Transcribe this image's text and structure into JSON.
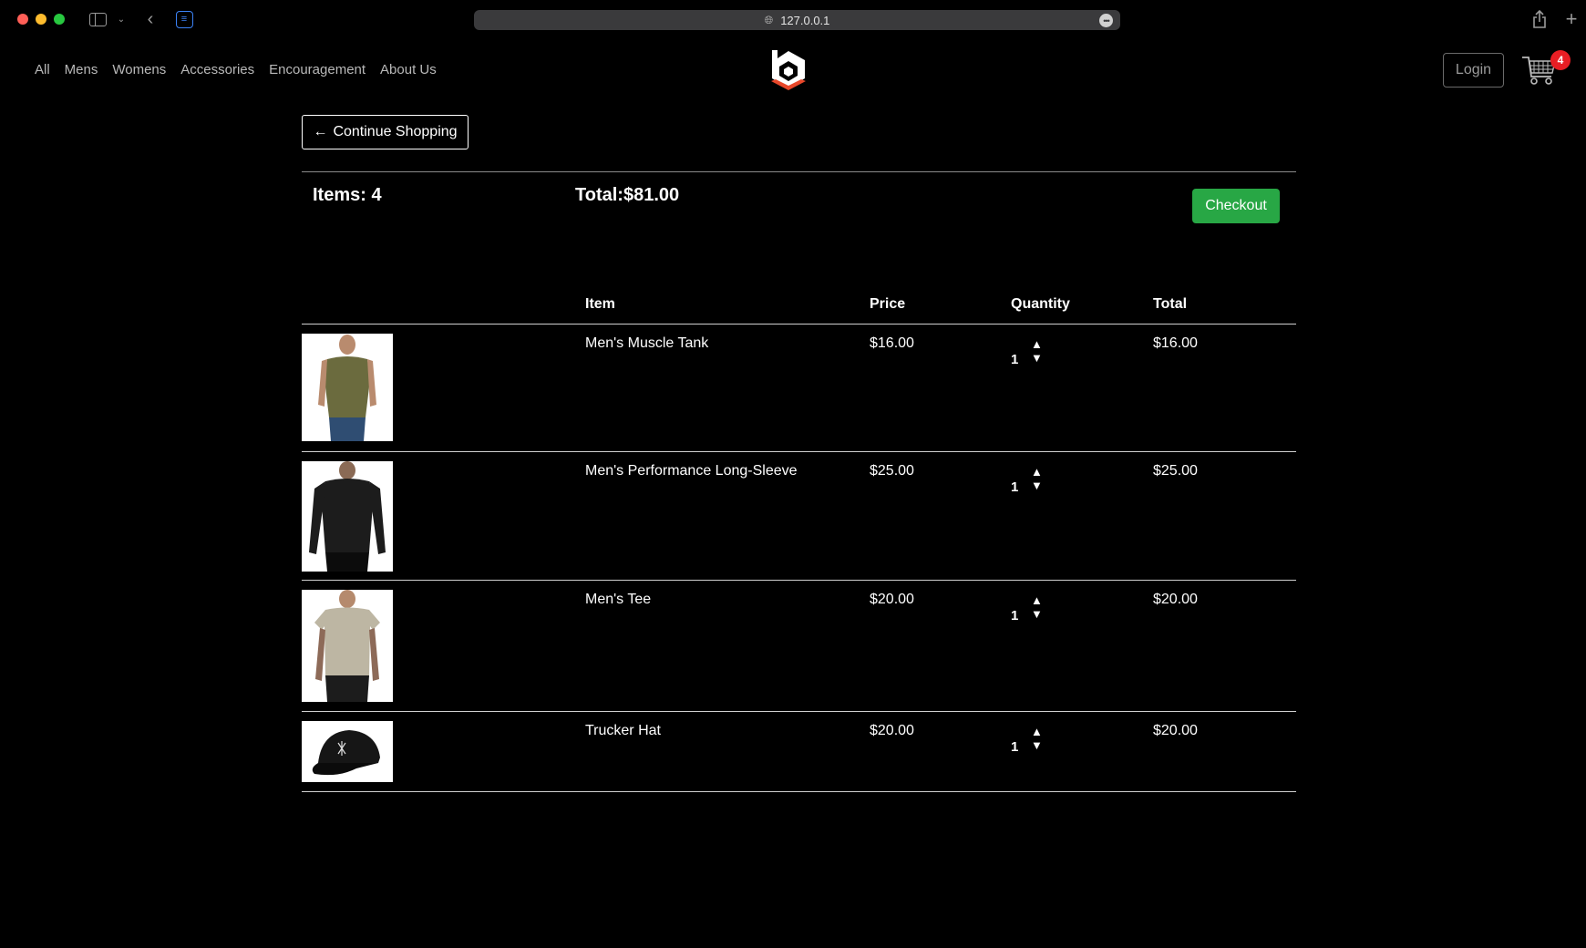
{
  "browser": {
    "url": "127.0.0.1",
    "icons": [
      "sidebar-icon",
      "chevron-down-icon",
      "back-arrow-icon",
      "extension-icon",
      "globe-icon",
      "more-icon",
      "share-icon",
      "new-tab-icon"
    ]
  },
  "nav": {
    "links": [
      "All",
      "Mens",
      "Womens",
      "Accessories",
      "Encouragement",
      "About Us"
    ],
    "login_label": "Login",
    "cart_count": "4"
  },
  "continue_label": "Continue Shopping",
  "summary": {
    "items_text": "Items: 4",
    "total_text": "Total:$81.00",
    "checkout_label": "Checkout"
  },
  "table": {
    "headers": {
      "item": "Item",
      "price": "Price",
      "quantity": "Quantity",
      "total": "Total"
    },
    "rows": [
      {
        "name": "Men's Muscle Tank",
        "price": "$16.00",
        "quantity": "1",
        "total": "$16.00"
      },
      {
        "name": "Men's Performance Long-Sleeve",
        "price": "$25.00",
        "quantity": "1",
        "total": "$25.00"
      },
      {
        "name": "Men's Tee",
        "price": "$20.00",
        "quantity": "1",
        "total": "$20.00"
      },
      {
        "name": "Trucker Hat",
        "price": "$20.00",
        "quantity": "1",
        "total": "$20.00"
      }
    ]
  },
  "colors": {
    "checkout": "#28a745",
    "badge": "#e81e24",
    "logo_accent": "#e8472a"
  }
}
